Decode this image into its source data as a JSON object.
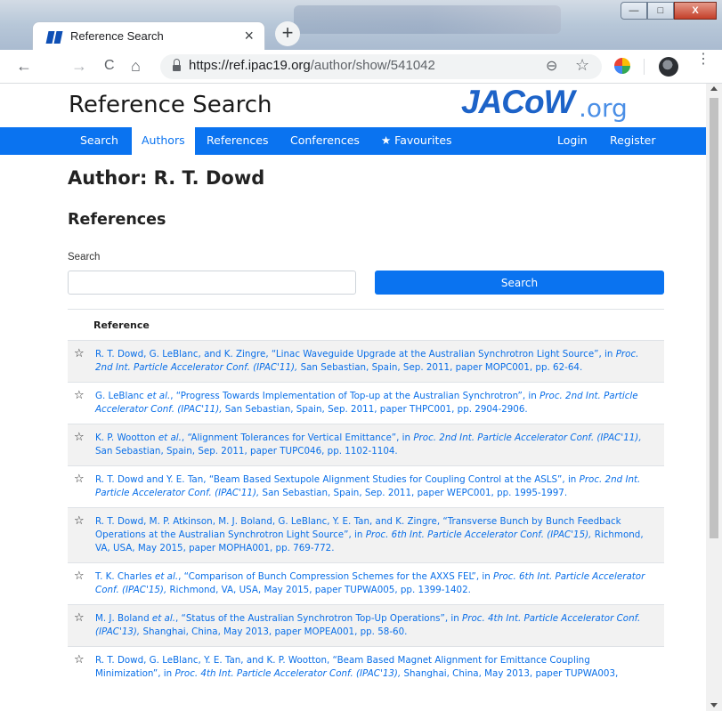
{
  "browser": {
    "tab_title": "Reference Search",
    "tab_close": "×",
    "new_tab": "+",
    "url_host": "https://ref.ipac19.org",
    "url_path": "/author/show/541042",
    "back": "←",
    "forward": "→",
    "reload": "C",
    "home": "⌂",
    "zoom": "⊖",
    "star": "☆",
    "menu": "⋮",
    "minimize": "—",
    "maximize": "□",
    "close": "X"
  },
  "site": {
    "title": "Reference Search",
    "logo_main": "JACoW",
    "logo_suffix": ".org"
  },
  "nav": {
    "search": "Search",
    "authors": "Authors",
    "references": "References",
    "conferences": "Conferences",
    "favourites": "★ Favourites",
    "login": "Login",
    "register": "Register"
  },
  "main": {
    "author_heading": "Author: R. T. Dowd",
    "references_heading": "References",
    "search_label": "Search",
    "search_value": "",
    "search_button": "Search",
    "table_header": "Reference"
  },
  "references": [
    {
      "authors": "R. T. Dowd, G. LeBlanc, and K. Zingre, “Linac Waveguide Upgrade at the Australian Synchrotron Light Source”, in ",
      "venue": "Proc. 2nd Int. Particle Accelerator Conf. (IPAC'11),",
      "rest": " San Sebastian, Spain, Sep. 2011, paper MOPC001, pp. 62-64."
    },
    {
      "authors": "G. LeBlanc ",
      "etal": "et al.",
      "authors2": ", “Progress Towards Implementation of Top-up at the Australian Synchrotron”, in ",
      "venue": "Proc. 2nd Int. Particle Accelerator Conf. (IPAC'11),",
      "rest": " San Sebastian, Spain, Sep. 2011, paper THPC001, pp. 2904-2906."
    },
    {
      "authors": "K. P. Wootton ",
      "etal": "et al.",
      "authors2": ", “Alignment Tolerances for Vertical Emittance”, in ",
      "venue": "Proc. 2nd Int. Particle Accelerator Conf. (IPAC'11),",
      "rest": " San Sebastian, Spain, Sep. 2011, paper TUPC046, pp. 1102-1104."
    },
    {
      "authors": "R. T. Dowd and Y. E. Tan, “Beam Based Sextupole Alignment Studies for Coupling Control at the ASLS”, in ",
      "venue": "Proc. 2nd Int. Particle Accelerator Conf. (IPAC'11),",
      "rest": " San Sebastian, Spain, Sep. 2011, paper WEPC001, pp. 1995-1997."
    },
    {
      "authors": "R. T. Dowd, M. P. Atkinson, M. J. Boland, G. LeBlanc, Y. E. Tan, and K. Zingre, “Transverse Bunch by Bunch Feedback Operations at the Australian Synchrotron Light Source”, in ",
      "venue": "Proc. 6th Int. Particle Accelerator Conf. (IPAC'15),",
      "rest": " Richmond, VA, USA, May 2015, paper MOPHA001, pp. 769-772."
    },
    {
      "authors": "T. K. Charles ",
      "etal": "et al.",
      "authors2": ", “Comparison of Bunch Compression Schemes for the AXXS FEL”, in ",
      "venue": "Proc. 6th Int. Particle Accelerator Conf. (IPAC'15),",
      "rest": " Richmond, VA, USA, May 2015, paper TUPWA005, pp. 1399-1402."
    },
    {
      "authors": "M. J. Boland ",
      "etal": "et al.",
      "authors2": ", “Status of the Australian Synchrotron Top-Up Operations”, in ",
      "venue": "Proc. 4th Int. Particle Accelerator Conf. (IPAC'13),",
      "rest": " Shanghai, China, May 2013, paper MOPEA001, pp. 58-60."
    },
    {
      "authors": "R. T. Dowd, G. LeBlanc, Y. E. Tan, and K. P. Wootton, “Beam Based Magnet Alignment for Emittance Coupling Minimization”, in ",
      "venue": "Proc. 4th Int. Particle Accelerator Conf. (IPAC'13),",
      "rest": " Shanghai, China, May 2013, paper TUPWA003,"
    }
  ]
}
